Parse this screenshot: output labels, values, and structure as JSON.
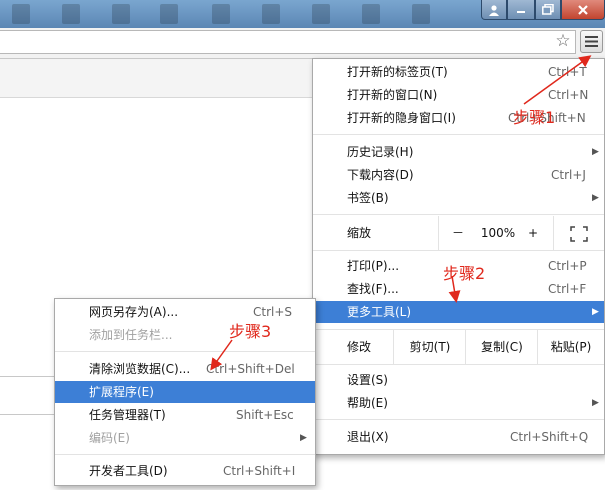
{
  "toolbar": {
    "star_icon": "star-icon",
    "menu_icon": "hamburger-menu-icon"
  },
  "main_menu": {
    "items": [
      {
        "label": "打开新的标签页(T)",
        "shortcut": "Ctrl+T"
      },
      {
        "label": "打开新的窗口(N)",
        "shortcut": "Ctrl+N"
      },
      {
        "label": "打开新的隐身窗口(I)",
        "shortcut": "Ctrl+Shift+N"
      },
      {
        "label": "历史记录(H)"
      },
      {
        "label": "下载内容(D)",
        "shortcut": "Ctrl+J"
      },
      {
        "label": "书签(B)"
      },
      {
        "label": "打印(P)...",
        "shortcut": "Ctrl+P"
      },
      {
        "label": "查找(F)...",
        "shortcut": "Ctrl+F"
      },
      {
        "label": "更多工具(L)"
      },
      {
        "label": "设置(S)"
      },
      {
        "label": "帮助(E)"
      },
      {
        "label": "退出(X)",
        "shortcut": "Ctrl+Shift+Q"
      }
    ],
    "zoom": {
      "label": "缩放",
      "minus": "－",
      "value": "100%",
      "plus": "+"
    },
    "edit": {
      "label": "修改",
      "cut": "剪切(T)",
      "copy": "复制(C)",
      "paste": "粘贴(P)"
    }
  },
  "sub_menu": {
    "items": [
      {
        "label": "网页另存为(A)...",
        "shortcut": "Ctrl+S"
      },
      {
        "label": "添加到任务栏..."
      },
      {
        "label": "清除浏览数据(C)...",
        "shortcut": "Ctrl+Shift+Del"
      },
      {
        "label": "扩展程序(E)"
      },
      {
        "label": "任务管理器(T)",
        "shortcut": "Shift+Esc"
      },
      {
        "label": "编码(E)"
      },
      {
        "label": "开发者工具(D)",
        "shortcut": "Ctrl+Shift+I"
      }
    ]
  },
  "annotations": {
    "step1": "步骤1",
    "step2": "步骤2",
    "step3": "步骤3"
  },
  "colors": {
    "highlight": "#3d7fd6",
    "annotation": "#e0281c"
  }
}
